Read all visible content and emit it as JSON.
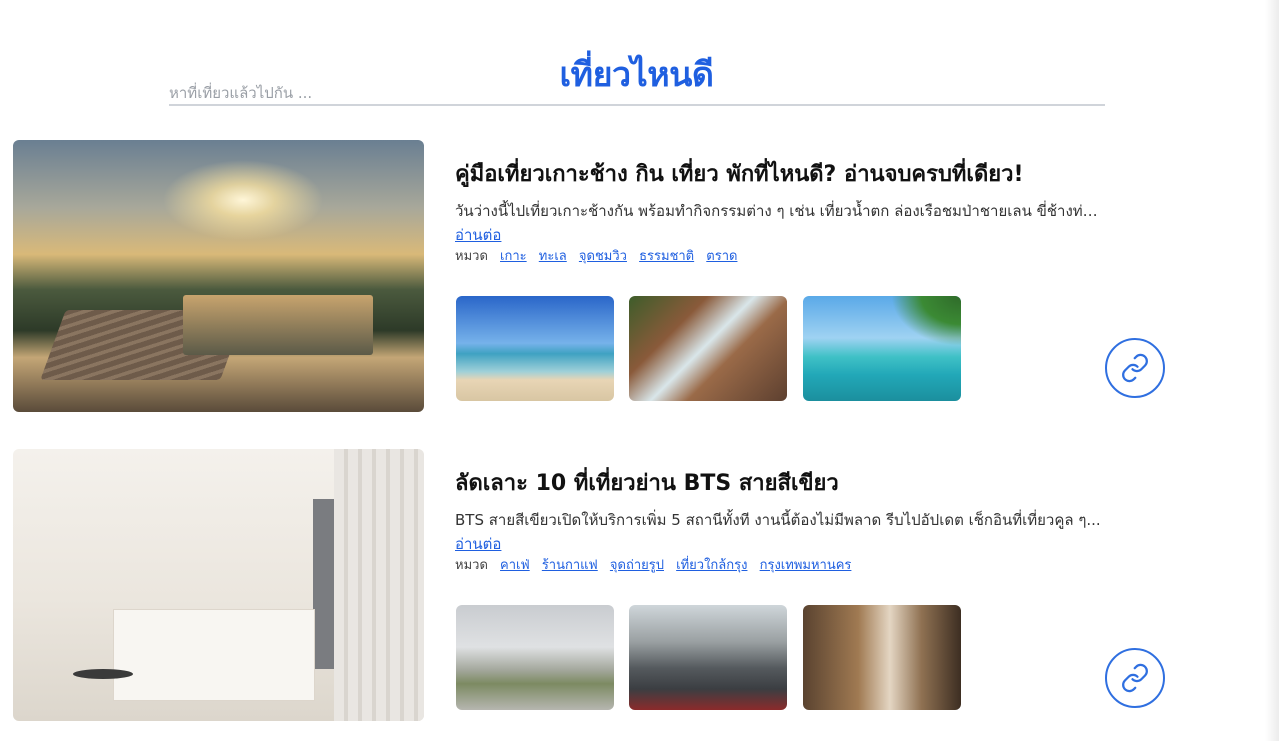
{
  "page": {
    "title": "เที่ยวไหนดี",
    "search_placeholder": "หาที่เที่ยวแล้วไปกัน ..."
  },
  "colors": {
    "accent": "#1f5fe0"
  },
  "articles": [
    {
      "title": "คู่มือเที่ยวเกาะช้าง กิน เที่ยว พักที่ไหนดี? อ่านจบครบที่เดียว!",
      "excerpt": "วันว่างนี้ไปเที่ยวเกาะช้างกัน พร้อมทำกิจกรรมต่าง ๆ เช่น เที่ยวน้ำตก ล่องเรือชมป่าชายเลน ขี่ช้างท่องป...",
      "read_more": "อ่านต่อ",
      "tag_label": "หมวด",
      "tags": [
        "เกาะ",
        "ทะเล",
        "จุดชมวิว",
        "ธรรมชาติ",
        "ตราด"
      ],
      "hero_image": "resort-pool-sunset",
      "thumbnails": [
        "beach",
        "waterfall",
        "island-sea"
      ],
      "link_icon": "link-icon"
    },
    {
      "title": "ลัดเลาะ 10 ที่เที่ยวย่าน BTS สายสีเขียว",
      "excerpt": "BTS สายสีเขียวเปิดให้บริการเพิ่ม 5 สถานีทั้งที งานนี้ต้องไม่มีพลาด รีบไปอัปเดต เช็กอินที่เที่ยวคูล ๆ...",
      "read_more": "อ่านต่อ",
      "tag_label": "หมวด",
      "tags": [
        "คาเฟ่",
        "ร้านกาแฟ",
        "จุดถ่ายรูป",
        "เที่ยวใกล้กรุง",
        "กรุงเทพมหานคร"
      ],
      "hero_image": "white-cafe-interior",
      "thumbnails": [
        "city-church",
        "go-kart",
        "shop-front"
      ],
      "link_icon": "link-icon"
    }
  ]
}
